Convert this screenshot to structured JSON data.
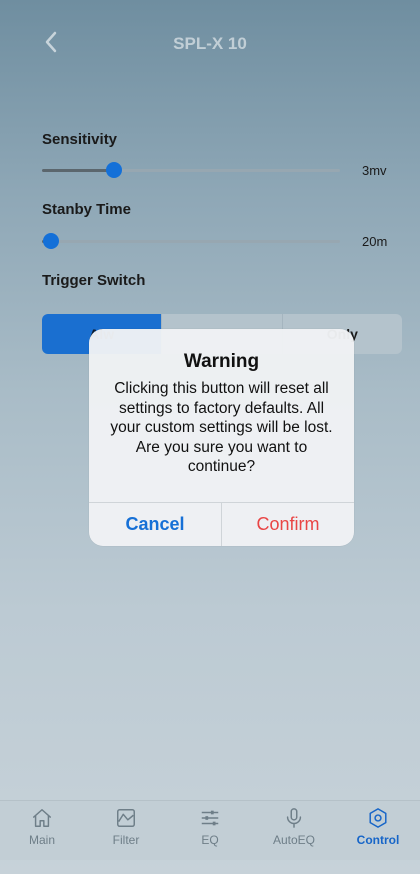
{
  "header": {
    "title": "SPL-X 10"
  },
  "settings": {
    "sensitivity": {
      "label": "Sensitivity",
      "value": "3mv",
      "level": 0.24
    },
    "standby": {
      "label": "Stanby Time",
      "value": "20m",
      "level": 0.03
    },
    "trigger": {
      "label": "Trigger Switch",
      "options": [
        "Alw",
        "",
        "Only"
      ],
      "selected": 0
    }
  },
  "modal": {
    "title": "Warning",
    "message": "Clicking this button will reset all settings to factory defaults. All your custom settings will be lost. Are you sure you want to continue?",
    "cancel": "Cancel",
    "confirm": "Confirm"
  },
  "tabs": [
    {
      "label": "Main",
      "icon": "home-icon"
    },
    {
      "label": "Filter",
      "icon": "filter-icon"
    },
    {
      "label": "EQ",
      "icon": "eq-icon"
    },
    {
      "label": "AutoEQ",
      "icon": "microphone-icon"
    },
    {
      "label": "Control",
      "icon": "control-icon"
    }
  ],
  "active_tab": 4,
  "colors": {
    "accent": "#1470d8",
    "danger": "#e94545"
  }
}
